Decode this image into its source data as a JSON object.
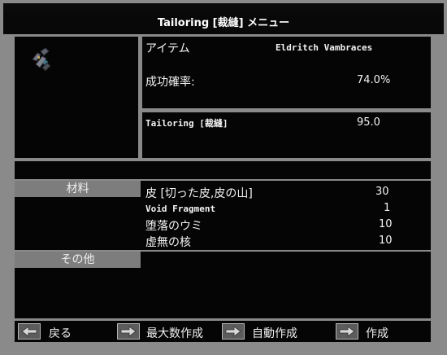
{
  "window": {
    "title": "Tailoring [裁縫] メニュー"
  },
  "item": {
    "label": "アイテム",
    "name": "Eldritch Vambraces",
    "icon": "vambraces-icon"
  },
  "success": {
    "label": "成功確率:",
    "value": "74.0%"
  },
  "skill": {
    "label": "Tailoring [裁縫]",
    "value": "95.0"
  },
  "sections": {
    "materials": "材料",
    "other": "その他"
  },
  "materials": [
    {
      "name": "皮 [切った皮,皮の山]",
      "qty": "30"
    },
    {
      "name": "Void Fragment",
      "qty": "1"
    },
    {
      "name": "堕落のウミ",
      "qty": "10"
    },
    {
      "name": "虚無の核",
      "qty": "10"
    }
  ],
  "buttons": {
    "back": "戻る",
    "make_max": "最大数作成",
    "auto_make": "自動作成",
    "make": "作成"
  }
}
